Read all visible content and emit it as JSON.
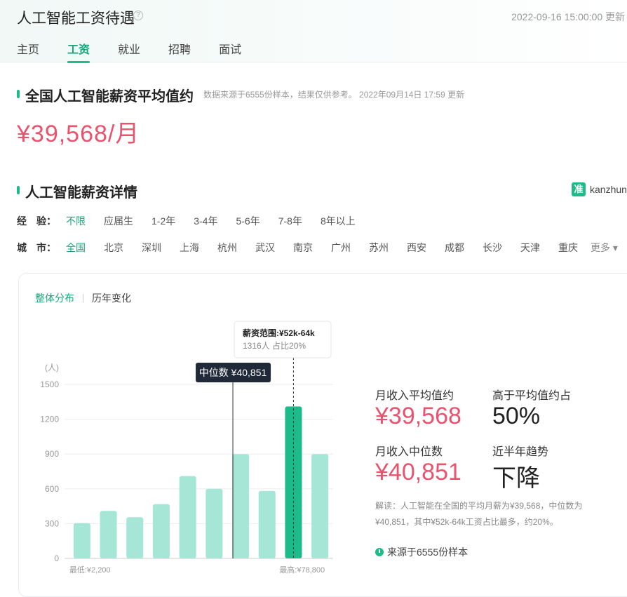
{
  "header": {
    "title": "人工智能工资待遇",
    "help_icon": "?",
    "timestamp": "2022-09-16 15:00:00 更新"
  },
  "tabs": [
    {
      "label": "主页",
      "active": false
    },
    {
      "label": "工资",
      "active": true
    },
    {
      "label": "就业",
      "active": false
    },
    {
      "label": "招聘",
      "active": false
    },
    {
      "label": "面试",
      "active": false
    }
  ],
  "average": {
    "title": "全国人工智能薪资平均值约",
    "meta": "数据来源于6555份样本，结果仅供参考。  2022年09月14日 17:59 更新",
    "value": "¥39,568/月"
  },
  "details": {
    "title": "人工智能薪资详情",
    "brand_logo": "准",
    "brand_text": "kanzhun"
  },
  "filters": {
    "experience": {
      "label": "经　验：",
      "options": [
        "不限",
        "应届生",
        "1-2年",
        "3-4年",
        "5-6年",
        "7-8年",
        "8年以上"
      ],
      "active": 0
    },
    "city": {
      "label": "城　市：",
      "options": [
        "全国",
        "北京",
        "深圳",
        "上海",
        "杭州",
        "武汉",
        "南京",
        "广州",
        "苏州",
        "西安",
        "成都",
        "长沙",
        "天津",
        "重庆"
      ],
      "active": 0,
      "more": "更多 ▾"
    }
  },
  "view_tabs": [
    "整体分布",
    "历年变化"
  ],
  "chart_data": {
    "type": "bar",
    "ylabel": "(人)",
    "yticks": [
      "1500",
      "1200",
      "900",
      "600",
      "300",
      "0"
    ],
    "ylim": [
      0,
      1500
    ],
    "values": [
      305,
      410,
      355,
      468,
      710,
      600,
      900,
      582,
      1310,
      900
    ],
    "highlight_index": 8,
    "min_label": "最低:¥2,200",
    "max_label": "最高:¥78,800",
    "median_label": "中位数 ¥40,851",
    "median_index": 6,
    "tooltip": {
      "title": "薪资范围:¥52k-64k",
      "detail": "1316人  占比20%"
    },
    "bar_color": "#a6e6d7",
    "highlight_color": "#1dbb8a"
  },
  "stats": {
    "avg_label": "月收入平均值约",
    "avg_value": "¥39,568",
    "above_label": "高于平均值约占",
    "above_value": "50%",
    "median_label": "月收入中位数",
    "median_value": "¥40,851",
    "trend_label": "近半年趋势",
    "trend_value": "下降"
  },
  "interpretation": "解读：人工智能在全国的平均月薪为¥39,568，中位数为¥40,851，其中¥52k-64k工资占比最多，约20%。",
  "source": "来源于6555份样本"
}
